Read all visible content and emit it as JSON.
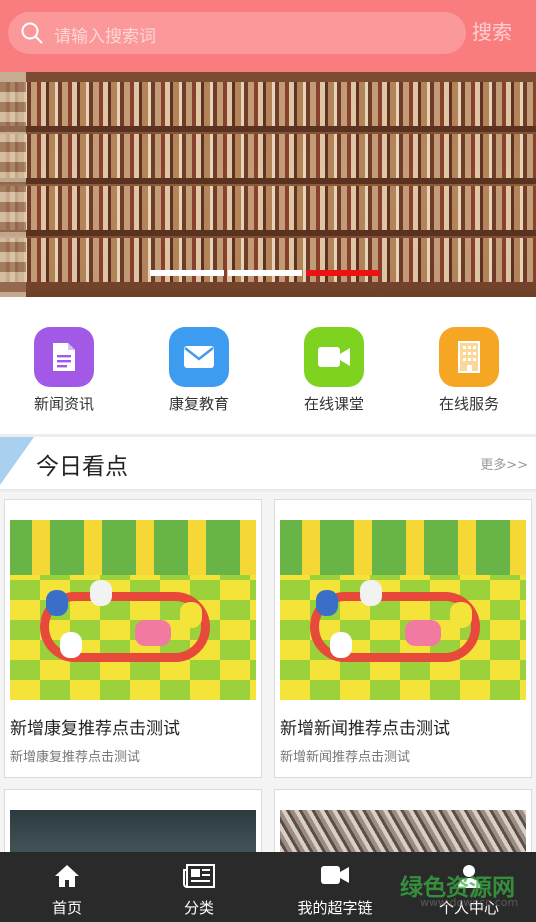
{
  "search": {
    "placeholder": "请输入搜索词",
    "button_label": "搜索"
  },
  "banner": {
    "slide_count": 3,
    "active_slide": 3
  },
  "quick_links": [
    {
      "label": "新闻资讯",
      "icon": "document-icon",
      "color": "#a259e6"
    },
    {
      "label": "康复教育",
      "icon": "mail-icon",
      "color": "#3d9bf0"
    },
    {
      "label": "在线课堂",
      "icon": "video-camera-icon",
      "color": "#7ed321"
    },
    {
      "label": "在线服务",
      "icon": "building-icon",
      "color": "#f5a623"
    }
  ],
  "section": {
    "title": "今日看点",
    "more_label": "更多>>"
  },
  "cards": [
    {
      "title": "新增康复推荐点击测试",
      "subtitle": "新增康复推荐点击测试"
    },
    {
      "title": "新增新闻推荐点击测试",
      "subtitle": "新增新闻推荐点击测试"
    }
  ],
  "tabbar": [
    {
      "label": "首页",
      "icon": "home-icon"
    },
    {
      "label": "分类",
      "icon": "newspaper-icon"
    },
    {
      "label": "我的超字链",
      "icon": "video-camera-icon"
    },
    {
      "label": "个人中心",
      "icon": "user-icon"
    }
  ],
  "watermark": {
    "text": "绿色资源网",
    "url": "www.downcc.com"
  },
  "colors": {
    "header": "#f97c7e",
    "active_dot": "#ee1111",
    "tabbar": "#2a2a2a"
  }
}
